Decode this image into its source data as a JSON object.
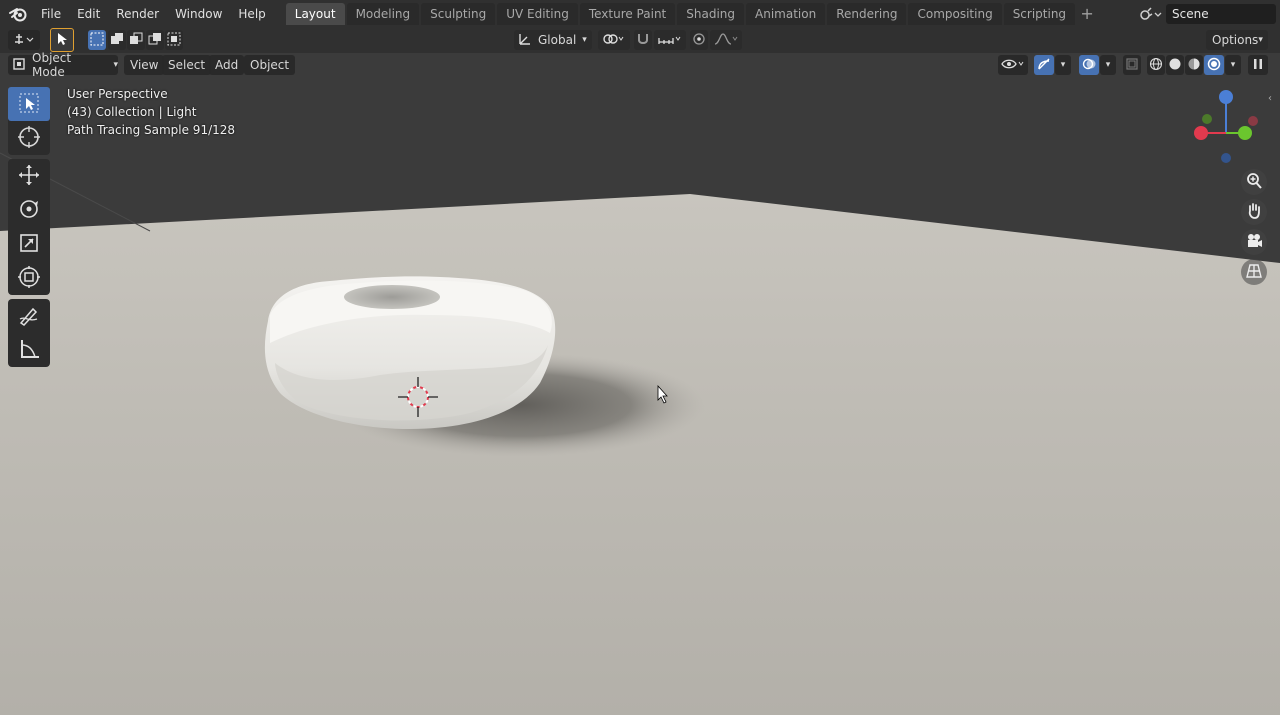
{
  "top_menu": {
    "items": [
      "File",
      "Edit",
      "Render",
      "Window",
      "Help"
    ]
  },
  "workspaces": {
    "tabs": [
      "Layout",
      "Modeling",
      "Sculpting",
      "UV Editing",
      "Texture Paint",
      "Shading",
      "Animation",
      "Rendering",
      "Compositing",
      "Scripting"
    ],
    "active": "Layout"
  },
  "scene": {
    "name": "Scene"
  },
  "header": {
    "orientation": "Global",
    "options_label": "Options"
  },
  "viewport_header": {
    "mode": "Object Mode",
    "menus": [
      "View",
      "Select",
      "Add",
      "Object"
    ]
  },
  "overlay_info": {
    "view": "User Perspective",
    "collection": "(43) Collection | Light",
    "render_status": "Path Tracing Sample 91/128"
  },
  "gizmo": {
    "axis_colors": {
      "x": "#e23a4e",
      "y": "#6bc62e",
      "z": "#4b7fd6"
    }
  },
  "colors": {
    "accent": "#4772b3",
    "background_world": "#3a3a3a",
    "floor": "#bdbab3"
  },
  "icons": {
    "tools": [
      "select-box-icon",
      "cursor-icon",
      "move-icon",
      "rotate-icon",
      "scale-icon",
      "transform-icon",
      "annotate-icon",
      "measure-icon"
    ],
    "navigation": [
      "zoom-icon",
      "pan-hand-icon",
      "camera-icon",
      "grid-view-icon"
    ]
  }
}
